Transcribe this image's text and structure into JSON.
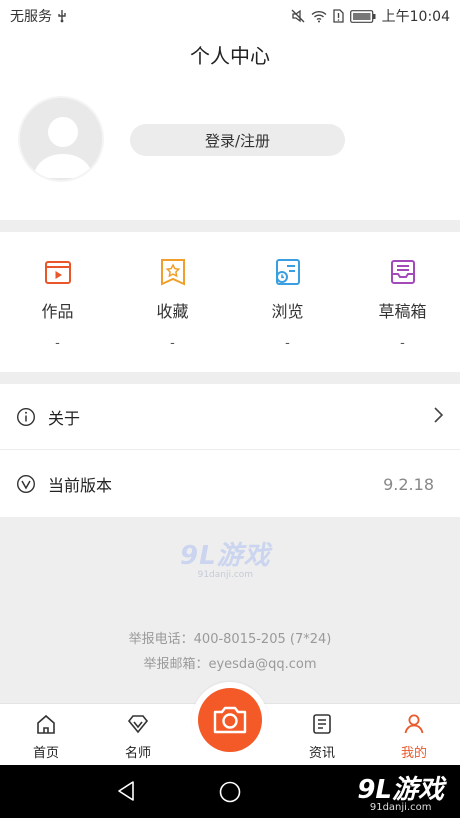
{
  "status_bar": {
    "carrier": "无服务",
    "time": "上午10:04"
  },
  "page_title": "个人中心",
  "profile": {
    "login_label": "登录/注册"
  },
  "stats": [
    {
      "label": "作品",
      "count": "-",
      "icon": "video-icon",
      "color": "#e8562a"
    },
    {
      "label": "收藏",
      "count": "-",
      "icon": "bookmark-star-icon",
      "color": "#f0a02a"
    },
    {
      "label": "浏览",
      "count": "-",
      "icon": "history-icon",
      "color": "#3a9fe0"
    },
    {
      "label": "草稿箱",
      "count": "-",
      "icon": "drafts-tray-icon",
      "color": "#a24bb8"
    }
  ],
  "menu": {
    "about_label": "关于",
    "version_label": "当前版本",
    "version_value": "9.2.18"
  },
  "footer": {
    "watermark": "9L游戏",
    "watermark_sub": "91danji.com",
    "report_phone": "举报电话：400-8015-205 (7*24)",
    "report_email": "举报邮箱：eyesda@qq.com"
  },
  "tabbar": {
    "home": "首页",
    "teacher": "名师",
    "news": "资讯",
    "mine": "我的",
    "active": "mine",
    "accent_color": "#ea5a2c"
  },
  "navbar": {
    "watermark": "9L游戏",
    "watermark_sub": "91danji.com"
  }
}
